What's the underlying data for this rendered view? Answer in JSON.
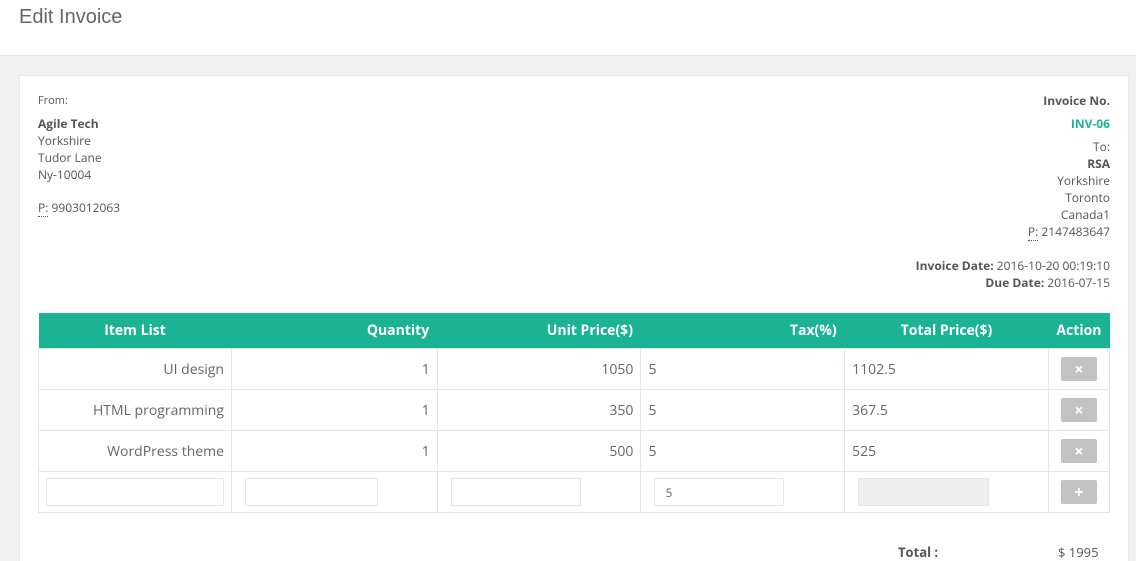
{
  "page": {
    "title": "Edit Invoice"
  },
  "from": {
    "label": "From:",
    "name": "Agile Tech",
    "address": [
      "Yorkshire",
      "Tudor Lane",
      "Ny-10004"
    ],
    "phone_abbr": "P:",
    "phone": "9903012063"
  },
  "invoice": {
    "label": "Invoice No.",
    "number": "INV-06",
    "to_label": "To:",
    "to_name": "RSA",
    "to_address": [
      "Yorkshire",
      "Toronto",
      "Canada1"
    ],
    "phone_abbr": "P:",
    "phone": "2147483647",
    "date_label": "Invoice Date:",
    "date": "2016-10-20 00:19:10",
    "due_label": "Due Date:",
    "due": "2016-07-15"
  },
  "table": {
    "headers": [
      "Item List",
      "Quantity",
      "Unit Price($)",
      "Tax(%)",
      "Total Price($)",
      "Action"
    ],
    "rows": [
      {
        "item": "UI design",
        "qty": "1",
        "unit": "1050",
        "tax": "5",
        "total": "1102.5"
      },
      {
        "item": "HTML programming",
        "qty": "1",
        "unit": "350",
        "tax": "5",
        "total": "367.5"
      },
      {
        "item": "WordPress theme",
        "qty": "1",
        "unit": "500",
        "tax": "5",
        "total": "525"
      }
    ],
    "new_row": {
      "item": "",
      "qty": "",
      "unit": "",
      "tax": "5",
      "total": ""
    },
    "delete_icon": "×",
    "add_icon": "+"
  },
  "summary": {
    "total_label": "Total :",
    "total_value": "$ 1995"
  }
}
